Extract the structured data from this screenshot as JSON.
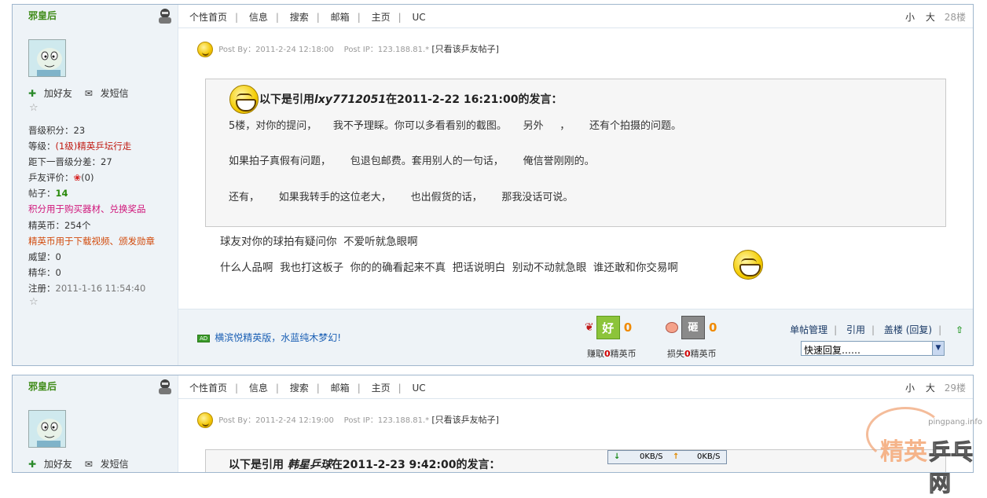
{
  "post1": {
    "user": {
      "name": "邪皇后",
      "add_friend": "加好友",
      "send_msg": "发短信",
      "stats": [
        {
          "label": "晋级积分：",
          "value": "23"
        },
        {
          "label": "等级：",
          "value": "(1级)精英乒坛行走"
        },
        {
          "label": "距下一晋级分差：",
          "value": "27"
        },
        {
          "label": "乒友评价：",
          "value": "(0)"
        },
        {
          "label": "帖子：",
          "value": "14"
        },
        {
          "label": "",
          "value": "积分用于购买器材、兑换奖品"
        },
        {
          "label": "精英币：",
          "value": "254个"
        },
        {
          "label": "",
          "value": "精英币用于下载视频、颁发勋章"
        },
        {
          "label": "威望：",
          "value": "0"
        },
        {
          "label": "精华：",
          "value": "0"
        },
        {
          "label": "注册：",
          "value": "2011-1-16 11:54:40"
        }
      ]
    },
    "nav": {
      "links": [
        "个性首页",
        "信息",
        "搜索",
        "邮箱",
        "主页",
        "UC"
      ],
      "small": "小",
      "big": "大",
      "floor": "28楼"
    },
    "meta": {
      "post_by": "Post By：2011-2-24 12:18:00",
      "post_ip": "Post IP：123.188.81.*",
      "only_view": "只看该乒友帖子"
    },
    "quote": {
      "head_pre": "以下是引用",
      "head_user": "lxy7712051",
      "head_post": "在2011-2-22 16:21:00的发言：",
      "lines": [
        "5楼，对你的提问，     我不予理睬。你可以多看看别的截图。     另外     ，      还有个拍摄的问题。",
        "如果拍子真假有问题，      包退包邮费。套用别人的一句话，      俺信誉刚刚的。",
        "还有，      如果我转手的这位老大，      也出假货的话，      那我没话可说。"
      ]
    },
    "body": [
      "球友对你的球拍有疑问你  不爱听就急眼啊",
      "什么人品啊  我也打这板子  你的的确看起来不真  把话说明白  别动不动就急眼  谁还敢和你交易啊"
    ],
    "footer": {
      "ad": "横滨悦精英版，水蓝纯木梦幻!",
      "good_icon": "好",
      "good_count": "0",
      "good_caption_pre": "赚取",
      "good_caption_num": "0",
      "good_caption_post": "精英币",
      "bad_icon": "砸",
      "bad_count": "0",
      "bad_caption_pre": "损失",
      "bad_caption_num": "0",
      "bad_caption_post": "精英币",
      "tools": [
        "单帖管理",
        "引用",
        "盖楼 (回复)"
      ],
      "quick_reply": "快速回复……"
    }
  },
  "post2": {
    "user": {
      "name": "邪皇后",
      "add_friend": "加好友",
      "send_msg": "发短信"
    },
    "nav": {
      "links": [
        "个性首页",
        "信息",
        "搜索",
        "邮箱",
        "主页",
        "UC"
      ],
      "small": "小",
      "big": "大",
      "floor": "29楼"
    },
    "meta": {
      "post_by": "Post By：2011-2-24 12:19:00",
      "post_ip": "Post IP：123.188.81.*",
      "only_view": "只看该乒友帖子"
    },
    "quote": {
      "head_pre": "以下是引用 ",
      "head_user": "韩星乒球",
      "head_post": "在2011-2-23 9:42:00的发言："
    }
  },
  "speed": {
    "down": "0KB/S",
    "up": "0KB/S"
  },
  "watermark": {
    "url": "pingpang.info",
    "left": "精英",
    "right": "乒乓网"
  }
}
